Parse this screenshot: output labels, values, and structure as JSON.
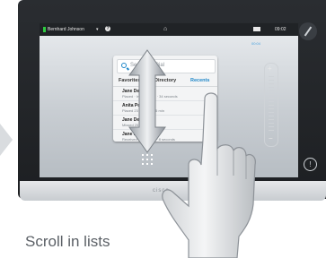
{
  "status_bar": {
    "user_name": "Bernhard Johnson",
    "clock": "09:02",
    "timer": "00:04"
  },
  "directory": {
    "search_placeholder": "Search or Dial",
    "tabs": [
      "Favorites",
      "Directory",
      "Recents"
    ],
    "active_tab": "Recents",
    "rows": [
      {
        "name": "Jane Dewe",
        "detail": "Placed · Incoming 37 · 34 seconds"
      },
      {
        "name": "Anita Pose",
        "detail": "Placed 23 · 09:22 · 15 min"
      },
      {
        "name": "Jane Dewe",
        "detail": "Missed 25 · 04"
      },
      {
        "name": "Jane Dewe",
        "detail": "Received · 07.5 · 1:3 · 8 seconds"
      }
    ]
  },
  "device": {
    "brand": "cisco"
  },
  "caption": "Scroll in lists",
  "colors": {
    "accent": "#1d86c8",
    "status_green": "#2ecc40"
  }
}
